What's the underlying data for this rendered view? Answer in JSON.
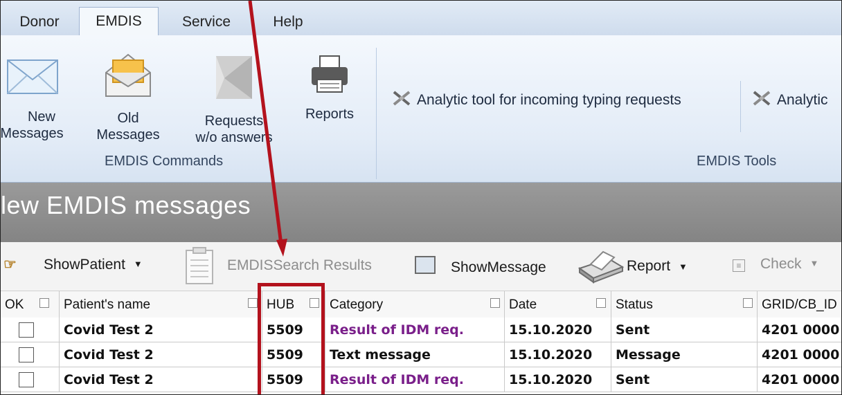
{
  "tabs": [
    {
      "label": "Donor"
    },
    {
      "label": "EMDIS"
    },
    {
      "label": "Service"
    },
    {
      "label": "Help"
    }
  ],
  "ribbon": {
    "commands": {
      "new_line1": "New",
      "new_line2": "Messages",
      "old_line1": "Old",
      "old_line2": "Messages",
      "req_line1": "Requests",
      "req_line2": "w/o answers",
      "reports": "Reports",
      "group_label": "EMDIS Commands"
    },
    "tools": {
      "tool1": "Analytic tool for incoming typing requests",
      "tool2": "Analytic",
      "group_label": "EMDIS Tools"
    }
  },
  "window_title": "lew EMDIS messages",
  "toolbar": {
    "show_patient": "ShowPatient",
    "emdis_search": "EMDISSearch Results",
    "show_message": "ShowMessage",
    "report": "Report",
    "check": "Check"
  },
  "grid": {
    "headers": {
      "ok": "OK",
      "patient": "Patient's name",
      "hub": "HUB",
      "category": "Category",
      "date": "Date",
      "status": "Status",
      "grid_id": "GRID/CB_ID"
    },
    "rows": [
      {
        "patient": "Covid Test 2",
        "hub": "5509",
        "category": "Result of IDM req.",
        "date": "15.10.2020",
        "status": "Sent",
        "grid_id": "4201 0000"
      },
      {
        "patient": "Covid Test 2",
        "hub": "5509",
        "category": "Text message",
        "date": "15.10.2020",
        "status": "Message",
        "grid_id": "4201 0000"
      },
      {
        "patient": "Covid Test 2",
        "hub": "5509",
        "category": "Result of IDM req.",
        "date": "15.10.2020",
        "status": "Sent",
        "grid_id": "4201 0000"
      }
    ]
  },
  "colors": {
    "annotation": "#b3121d",
    "category_result": "#7a1f8a",
    "category_text": "#111111"
  }
}
